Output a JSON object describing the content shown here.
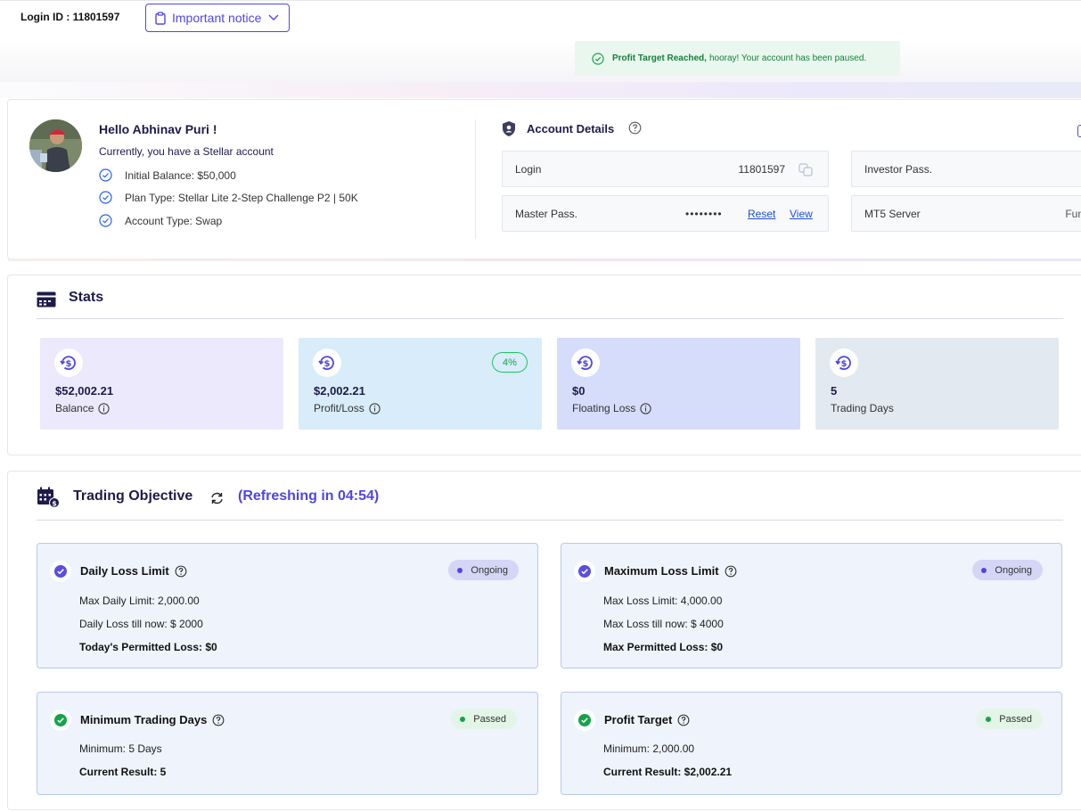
{
  "header": {
    "login_id": "Login ID : 11801597",
    "notice_label": "Important notice"
  },
  "toast": {
    "strong": "Profit Target Reached,",
    "text": "hooray! Your account has been paused.",
    "color": "#15803d"
  },
  "profile": {
    "greeting": "Hello Abhinav Puri !",
    "account_line": "Currently, you have a Stellar account",
    "bullets": [
      "Initial Balance: $50,000",
      "Plan Type: Stellar Lite 2-Step Challenge P2 | 50K",
      "Account Type: Swap"
    ]
  },
  "account_details": {
    "title": "Account Details",
    "login_label": "Login",
    "login_value": "11801597",
    "investor_label": "Investor Pass.",
    "master_label": "Master Pass.",
    "master_value": "••••••••",
    "reset_label": "Reset",
    "view_label": "View",
    "server_label": "MT5 Server",
    "server_value_partial": "Func"
  },
  "stats": {
    "title": "Stats",
    "cards": [
      {
        "amount": "$52,002.21",
        "label": "Balance",
        "bg": "#ebe9fb"
      },
      {
        "amount": "$2,002.21",
        "label": "Profit/Loss",
        "badge": "4%",
        "bg": "#d8ecf9"
      },
      {
        "amount": "$0",
        "label": "Floating Loss",
        "bg": "#d5ddfa"
      },
      {
        "amount": "5",
        "label": "Trading Days",
        "bg": "#e3e9f1"
      }
    ]
  },
  "objective": {
    "title": "Trading Objective",
    "refreshing": "(Refreshing in 04:54)",
    "items": [
      {
        "title": "Daily Loss Limit",
        "status": "Ongoing",
        "lines": [
          "Max Daily Limit: 2,000.00",
          "Daily Loss till now: $ 2000"
        ],
        "bold": "Today's Permitted Loss: $0"
      },
      {
        "title": "Maximum Loss Limit",
        "status": "Ongoing",
        "lines": [
          "Max Loss Limit: 4,000.00",
          "Max Loss till now: $ 4000"
        ],
        "bold": "Max Permitted Loss: $0"
      },
      {
        "title": "Minimum Trading Days",
        "status": "Passed",
        "lines": [
          "Minimum: 5 Days"
        ],
        "bold": "Current Result: 5"
      },
      {
        "title": "Profit Target",
        "status": "Passed",
        "lines": [
          "Minimum: 2,000.00"
        ],
        "bold": "Current Result: $2,002.21"
      }
    ]
  },
  "colors": {
    "accent": "#4f46e5",
    "passed": "#16a34a",
    "navy": "#1e1b4b"
  }
}
